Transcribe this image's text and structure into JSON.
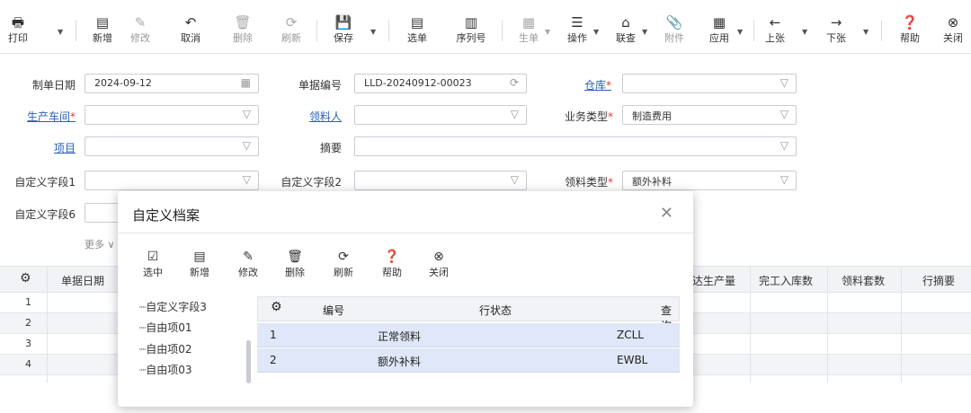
{
  "toolbar": {
    "print": "打印",
    "new": "新增",
    "edit": "修改",
    "cancel": "取消",
    "delete": "删除",
    "refresh": "刷新",
    "save": "保存",
    "select_doc": "选单",
    "serial": "序列号",
    "generate": "生单",
    "operate": "操作",
    "query": "联查",
    "attach": "附件",
    "apply": "应用",
    "prev": "上张",
    "next": "下张",
    "help": "帮助",
    "close": "关闭"
  },
  "form": {
    "date_label": "制单日期",
    "date_value": "2024-09-12",
    "docno_label": "单据编号",
    "docno_value": "LLD-20240912-00023",
    "warehouse_label": "仓库",
    "workshop_label": "生产车间",
    "picker_label": "领料人",
    "biztype_label": "业务类型",
    "biztype_value": "制造费用",
    "project_label": "项目",
    "summary_label": "摘要",
    "custom1_label": "自定义字段1",
    "custom2_label": "自定义字段2",
    "picktype_label": "领料类型",
    "picktype_value": "额外补料",
    "custom6_label": "自定义字段6",
    "more_label": "更多"
  },
  "grid": {
    "headers": [
      "单据日期",
      "达生产量",
      "完工入库数",
      "领料套数",
      "行摘要"
    ],
    "rows": [
      "1",
      "2",
      "3",
      "4"
    ]
  },
  "dialog": {
    "title": "自定义档案",
    "toolbar": [
      "选中",
      "新增",
      "修改",
      "删除",
      "刷新",
      "帮助",
      "关闭"
    ],
    "tree": [
      "自定义字段3",
      "自由项01",
      "自由项02",
      "自由项03"
    ],
    "columns": [
      "编号",
      "行状态",
      "查询"
    ],
    "rows": [
      {
        "no": "1",
        "status": "正常领料",
        "code": "ZCLL"
      },
      {
        "no": "2",
        "status": "额外补料",
        "code": "EWBL"
      }
    ]
  }
}
